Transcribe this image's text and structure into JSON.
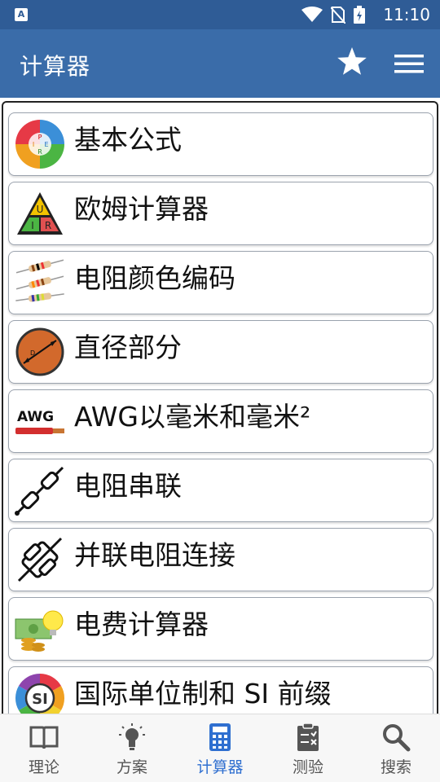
{
  "status_bar": {
    "app_indicator": "A",
    "time": "11:10"
  },
  "app_bar": {
    "title": "计算器",
    "star_icon": "star-icon",
    "menu_icon": "hamburger-menu-icon"
  },
  "items": [
    {
      "label": "基本公式",
      "icon": "formula-wheel-icon"
    },
    {
      "label": "欧姆计算器",
      "icon": "ohm-triangle-icon"
    },
    {
      "label": "电阻颜色编码",
      "icon": "resistor-color-icon"
    },
    {
      "label": "直径部分",
      "icon": "diameter-circle-icon"
    },
    {
      "label": "AWG以毫米和毫米²",
      "icon": "awg-wire-icon",
      "icon_text": "AWG"
    },
    {
      "label": "电阻串联",
      "icon": "series-resistor-icon"
    },
    {
      "label": "并联电阻连接",
      "icon": "parallel-resistor-icon"
    },
    {
      "label": "电费计算器",
      "icon": "money-bulb-icon"
    },
    {
      "label": "国际单位制和 SI 前缀",
      "icon": "si-units-icon",
      "icon_text": "SI"
    }
  ],
  "formula_icon_letters": {
    "top": "P",
    "left": "I",
    "right": "E",
    "bottom": "R"
  },
  "ohm_icon_letters": {
    "top": "U",
    "left": "I",
    "right": "R"
  },
  "bottom_nav": [
    {
      "label": "理论",
      "icon": "book-icon",
      "active": false
    },
    {
      "label": "方案",
      "icon": "lightbulb-icon",
      "active": false
    },
    {
      "label": "计算器",
      "icon": "calculator-icon",
      "active": true
    },
    {
      "label": "测验",
      "icon": "clipboard-icon",
      "active": false
    },
    {
      "label": "搜索",
      "icon": "search-icon",
      "active": false
    }
  ],
  "colors": {
    "status_bar": "#2f5c96",
    "app_bar": "#3a6ca9",
    "active_tab": "#2f6fd0",
    "inactive_tab": "#555555"
  }
}
